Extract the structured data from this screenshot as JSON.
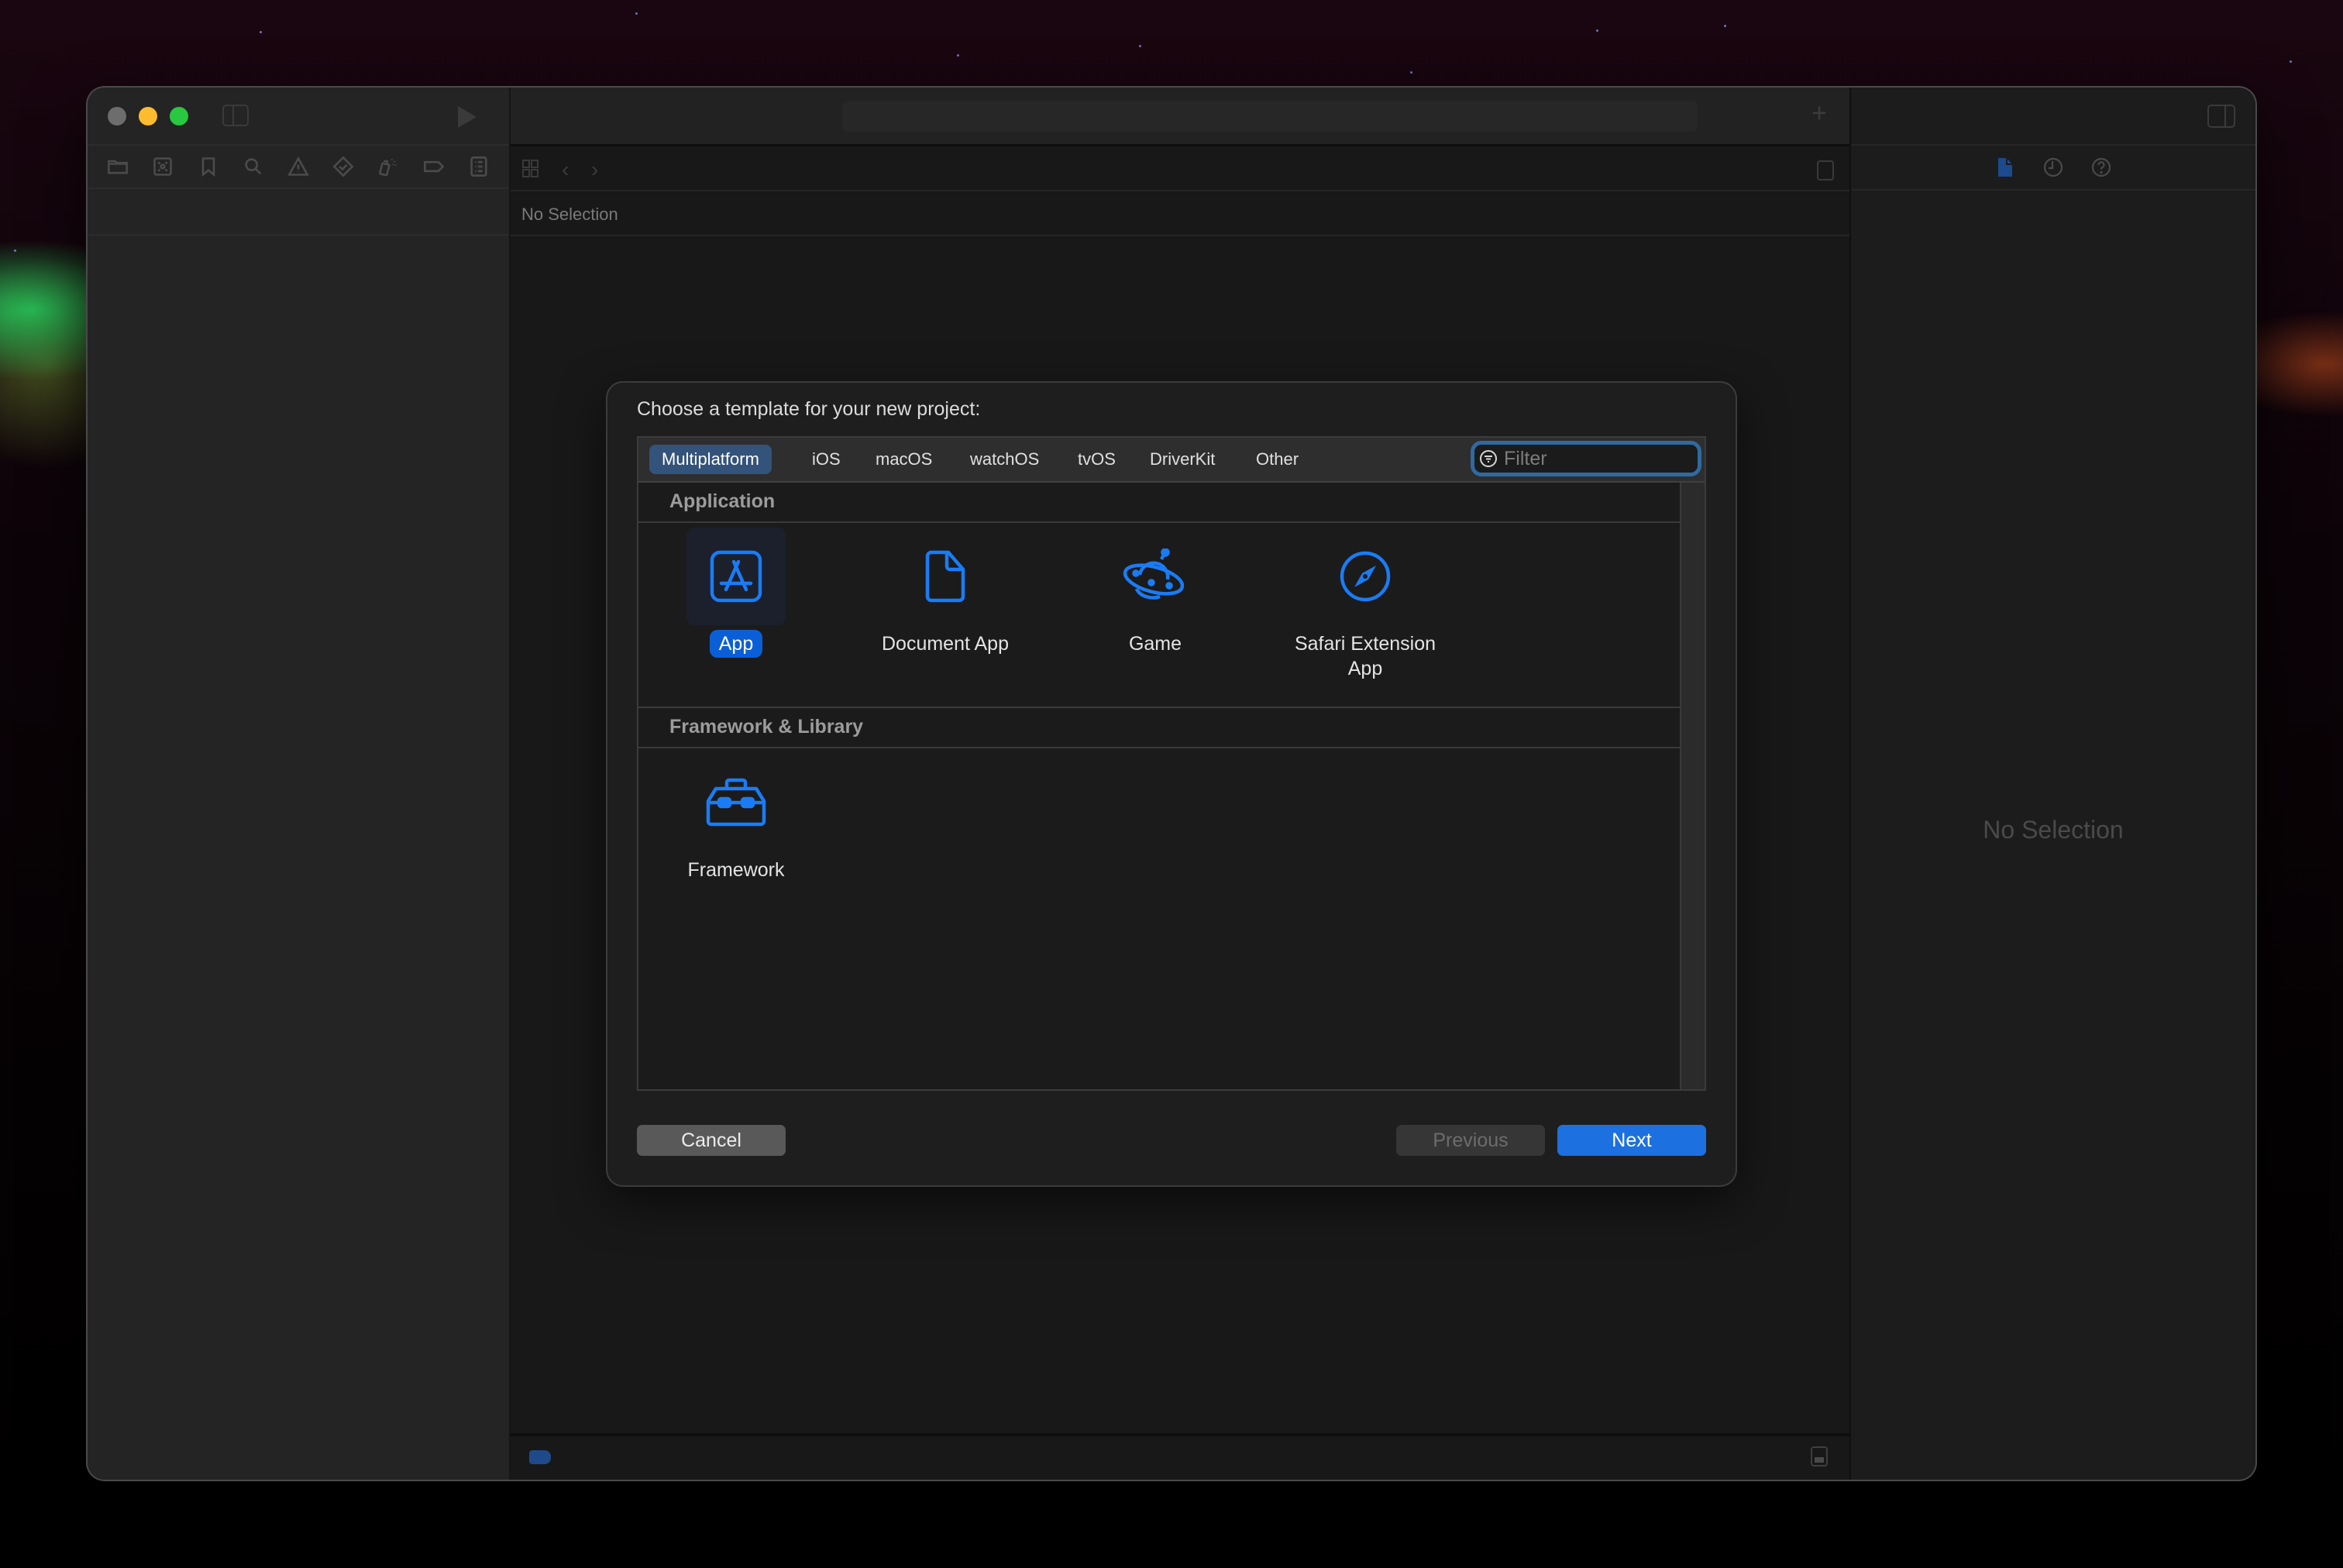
{
  "window": {
    "traffic_lights": [
      "close",
      "minimize",
      "zoom"
    ],
    "navigator_icons": [
      "folder-icon",
      "source-control-icon",
      "bookmark-icon",
      "search-icon",
      "warning-icon",
      "test-icon",
      "debug-icon",
      "breakpoint-icon",
      "report-icon"
    ],
    "editor": {
      "breadcrumb": "No Selection",
      "add_button_icon": "plus-icon"
    },
    "inspector": {
      "tabs": [
        "file-inspector-icon",
        "history-icon",
        "quick-help-icon"
      ],
      "active_tab": "file-inspector-icon",
      "empty_label": "No Selection"
    }
  },
  "dialog": {
    "title": "Choose a template for your new project:",
    "tabs": [
      {
        "label": "Multiplatform",
        "active": true
      },
      {
        "label": "iOS",
        "active": false
      },
      {
        "label": "macOS",
        "active": false
      },
      {
        "label": "watchOS",
        "active": false
      },
      {
        "label": "tvOS",
        "active": false
      },
      {
        "label": "DriverKit",
        "active": false
      },
      {
        "label": "Other",
        "active": false
      }
    ],
    "filter": {
      "placeholder": "Filter",
      "value": ""
    },
    "sections": [
      {
        "title": "Application",
        "templates": [
          {
            "label": "App",
            "icon": "app-store-icon",
            "selected": true
          },
          {
            "label": "Document App",
            "icon": "document-icon",
            "selected": false
          },
          {
            "label": "Game",
            "icon": "ufo-icon",
            "selected": false
          },
          {
            "label": "Safari Extension App",
            "icon": "compass-icon",
            "selected": false
          }
        ]
      },
      {
        "title": "Framework & Library",
        "templates": [
          {
            "label": "Framework",
            "icon": "toolbox-icon",
            "selected": false
          }
        ]
      }
    ],
    "buttons": {
      "cancel": "Cancel",
      "previous": "Previous",
      "next": "Next"
    },
    "colors": {
      "accent": "#0a5fd6",
      "icon_blue": "#1a7cf5",
      "active_tab": "#34537a",
      "filter_focus": "#2f6aa0"
    }
  }
}
